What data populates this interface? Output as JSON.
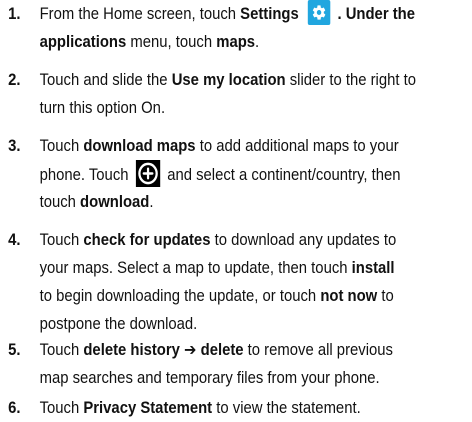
{
  "steps": [
    {
      "num": "1.",
      "l1_a": "From the Home screen, touch ",
      "l1_b": "Settings",
      "l1_c": ". Under the",
      "l2_a": "applications",
      "l2_b": " menu, touch ",
      "l2_c": "maps",
      "l2_d": ".",
      "icon": "gear-icon",
      "icon_color": "#21a6df"
    },
    {
      "num": "2.",
      "l1_a": "Touch and slide the ",
      "l1_b": "Use my location",
      "l1_c": " slider to the right to",
      "l2_a": "turn this option On."
    },
    {
      "num": "3.",
      "l1_a": "Touch ",
      "l1_b": "download maps",
      "l1_c": " to add additional maps to your",
      "l2_a": "phone. Touch",
      "l2_b": "and select a continent/country, then",
      "l3_a": "touch ",
      "l3_b": "download",
      "l3_c": ".",
      "icon": "add-circle-icon"
    },
    {
      "num": "4.",
      "l1_a": "Touch ",
      "l1_b": "check for updates",
      "l1_c": " to download any updates to",
      "l2_a": "your maps. Select a map to update, then touch ",
      "l2_b": "install",
      "l3_a": "to begin downloading the update, or touch ",
      "l3_b": "not now",
      "l3_c": " to",
      "l4_a": "postpone the download."
    },
    {
      "num": "5.",
      "l1_a": "Touch ",
      "l1_b": "delete history",
      "l1_c": " ➔ ",
      "l1_d": "delete",
      "l1_e": " to remove all previous",
      "l2_a": "map searches and temporary files from your phone."
    },
    {
      "num": "6.",
      "l1_a": "Touch ",
      "l1_b": "Privacy Statement",
      "l1_c": " to view the statement."
    }
  ]
}
